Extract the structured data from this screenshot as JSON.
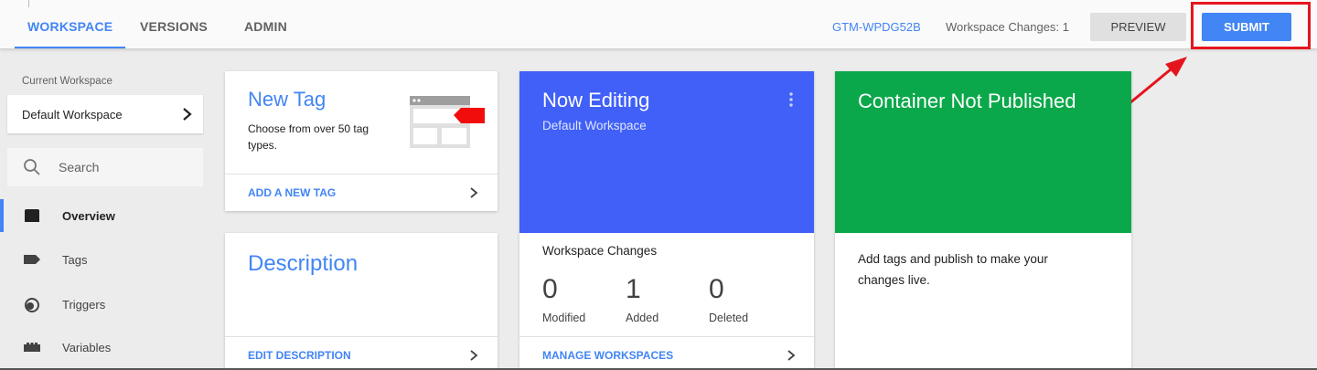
{
  "topbar": {
    "tabs": [
      {
        "label": "WORKSPACE",
        "active": true
      },
      {
        "label": "VERSIONS",
        "active": false
      },
      {
        "label": "ADMIN",
        "active": false
      }
    ],
    "container_id": "GTM-WPDG52B",
    "workspace_changes": "Workspace Changes: 1",
    "preview_label": "PREVIEW",
    "submit_label": "SUBMIT"
  },
  "sidebar": {
    "current_workspace_label": "Current Workspace",
    "workspace_name": "Default Workspace",
    "search_placeholder": "Search",
    "items": [
      {
        "label": "Overview",
        "icon": "overview-icon",
        "active": true
      },
      {
        "label": "Tags",
        "icon": "tag-icon",
        "active": false
      },
      {
        "label": "Triggers",
        "icon": "trigger-icon",
        "active": false
      },
      {
        "label": "Variables",
        "icon": "variables-icon",
        "active": false
      }
    ]
  },
  "cards": {
    "new_tag": {
      "title": "New Tag",
      "description": "Choose from over 50 tag types.",
      "link": "ADD A NEW TAG"
    },
    "description": {
      "title": "Description",
      "link": "EDIT DESCRIPTION"
    },
    "now_editing": {
      "title": "Now Editing",
      "subtitle": "Default Workspace",
      "changes_heading": "Workspace Changes",
      "modified_value": "0",
      "modified_label": "Modified",
      "added_value": "1",
      "added_label": "Added",
      "deleted_value": "0",
      "deleted_label": "Deleted",
      "link": "MANAGE WORKSPACES"
    },
    "not_published": {
      "title": "Container Not Published",
      "body": "Add tags and publish to make your changes live."
    }
  },
  "colors": {
    "accent": "#4285f4",
    "now_editing_bg": "#4060f8",
    "not_published_bg": "#0aa84a",
    "annotation": "#e5151d"
  }
}
